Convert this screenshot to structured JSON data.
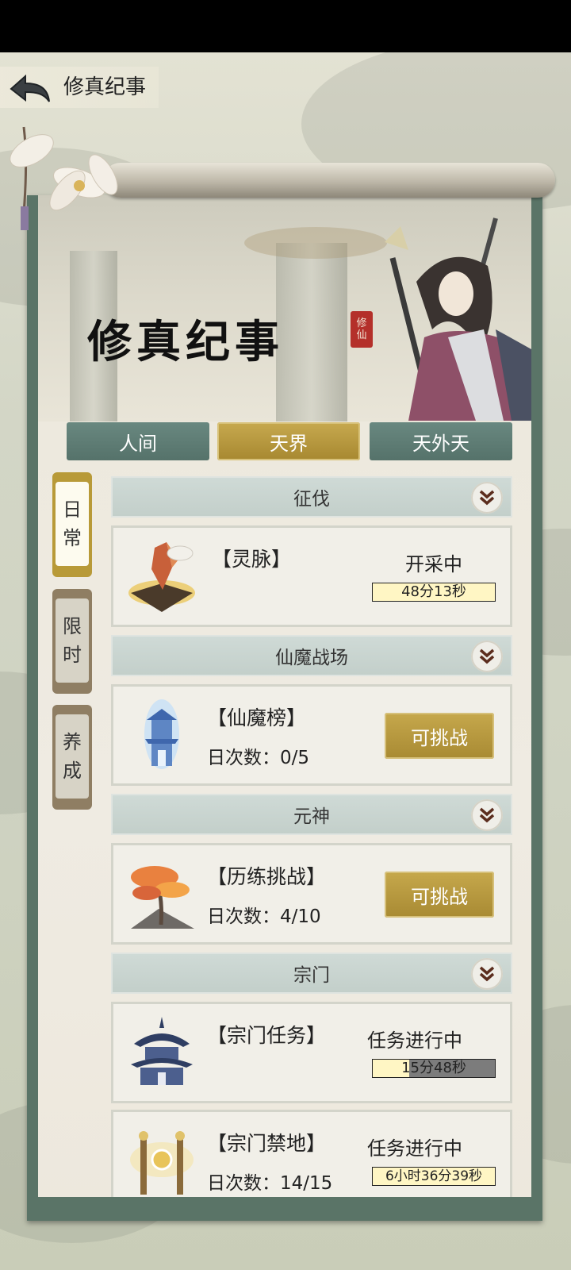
{
  "header": {
    "title": "修真纪事"
  },
  "banner": {
    "title": "修真纪事",
    "seal_top": "修",
    "seal_bottom": "仙"
  },
  "tabs": [
    {
      "label": "人间",
      "active": false
    },
    {
      "label": "天界",
      "active": true
    },
    {
      "label": "天外天",
      "active": false
    }
  ],
  "side_tabs": [
    {
      "line1": "日",
      "line2": "常",
      "active": true
    },
    {
      "line1": "限",
      "line2": "时",
      "active": false
    },
    {
      "line1": "养",
      "line2": "成",
      "active": false
    }
  ],
  "sections": [
    {
      "title": "征伐",
      "card": {
        "name": "【灵脉】",
        "status": "开采中",
        "timer": "48分13秒",
        "progress": 0.0
      }
    },
    {
      "title": "仙魔战场",
      "card": {
        "name": "【仙魔榜】",
        "count": "日次数：0/5",
        "button": "可挑战"
      }
    },
    {
      "title": "元神",
      "card": {
        "name": "【历练挑战】",
        "count": "日次数：4/10",
        "button": "可挑战"
      }
    },
    {
      "title": "宗门",
      "card": {
        "name": "【宗门任务】",
        "status": "任务进行中",
        "timer": "15分48秒",
        "progress": 0.3
      }
    }
  ],
  "extra_card": {
    "name": "【宗门禁地】",
    "count": "日次数：14/15",
    "status": "任务进行中",
    "timer": "6小时36分39秒",
    "progress": 0.0
  },
  "colors": {
    "accent_gold": "#b89a38",
    "tab_teal": "#5e7d75",
    "frame": "#5a7467"
  }
}
